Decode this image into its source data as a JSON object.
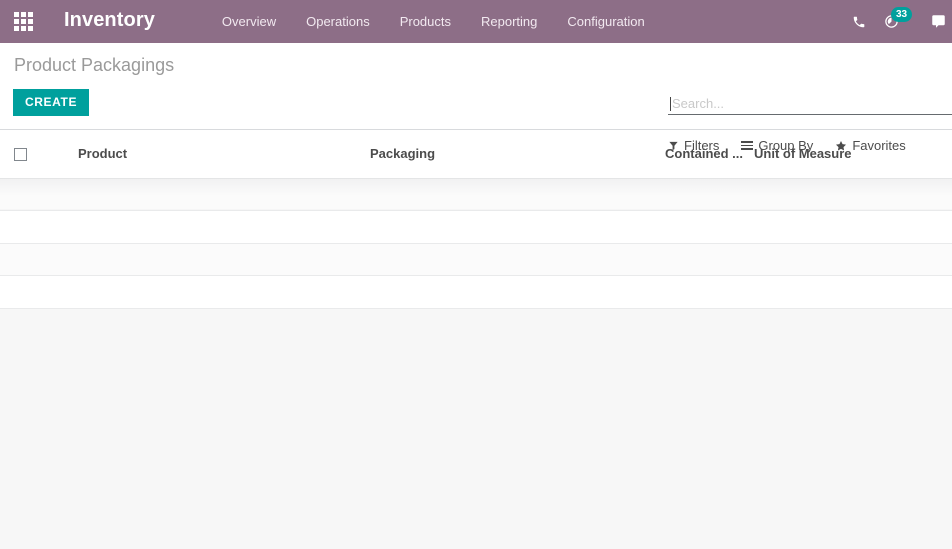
{
  "navbar": {
    "apps_icon": "apps-grid-icon",
    "brand": "Inventory",
    "menu_items": [
      {
        "label": "Overview"
      },
      {
        "label": "Operations"
      },
      {
        "label": "Products"
      },
      {
        "label": "Reporting"
      },
      {
        "label": "Configuration"
      }
    ],
    "icons": {
      "phone": "phone-icon",
      "activity": "clock-activity-icon",
      "messaging": "chat-bubble-icon"
    },
    "activity_count": "33",
    "colors": {
      "navbar_bg": "#8d6e87",
      "badge_bg": "#00A09D",
      "text": "#ffffff"
    }
  },
  "control_panel": {
    "breadcrumb": "Product Packagings",
    "create_label": "CREATE",
    "create_color": "#00A09D",
    "search": {
      "placeholder": "Search...",
      "value": ""
    },
    "filters": [
      {
        "label": "Filters",
        "icon": "funnel-icon"
      },
      {
        "label": "Group By",
        "icon": "hamburger-icon"
      },
      {
        "label": "Favorites",
        "icon": "star-icon"
      }
    ]
  },
  "list_view": {
    "columns": [
      {
        "key": "select",
        "label": ""
      },
      {
        "key": "product",
        "label": "Product"
      },
      {
        "key": "packaging",
        "label": "Packaging"
      },
      {
        "key": "contained",
        "label": "Contained ..."
      },
      {
        "key": "uom",
        "label": "Unit of Measure"
      }
    ],
    "rows": [
      {
        "product": "",
        "packaging": "",
        "contained": "",
        "uom": ""
      },
      {
        "product": "",
        "packaging": "",
        "contained": "",
        "uom": ""
      },
      {
        "product": "",
        "packaging": "",
        "contained": "",
        "uom": ""
      },
      {
        "product": "",
        "packaging": "",
        "contained": "",
        "uom": ""
      }
    ]
  }
}
